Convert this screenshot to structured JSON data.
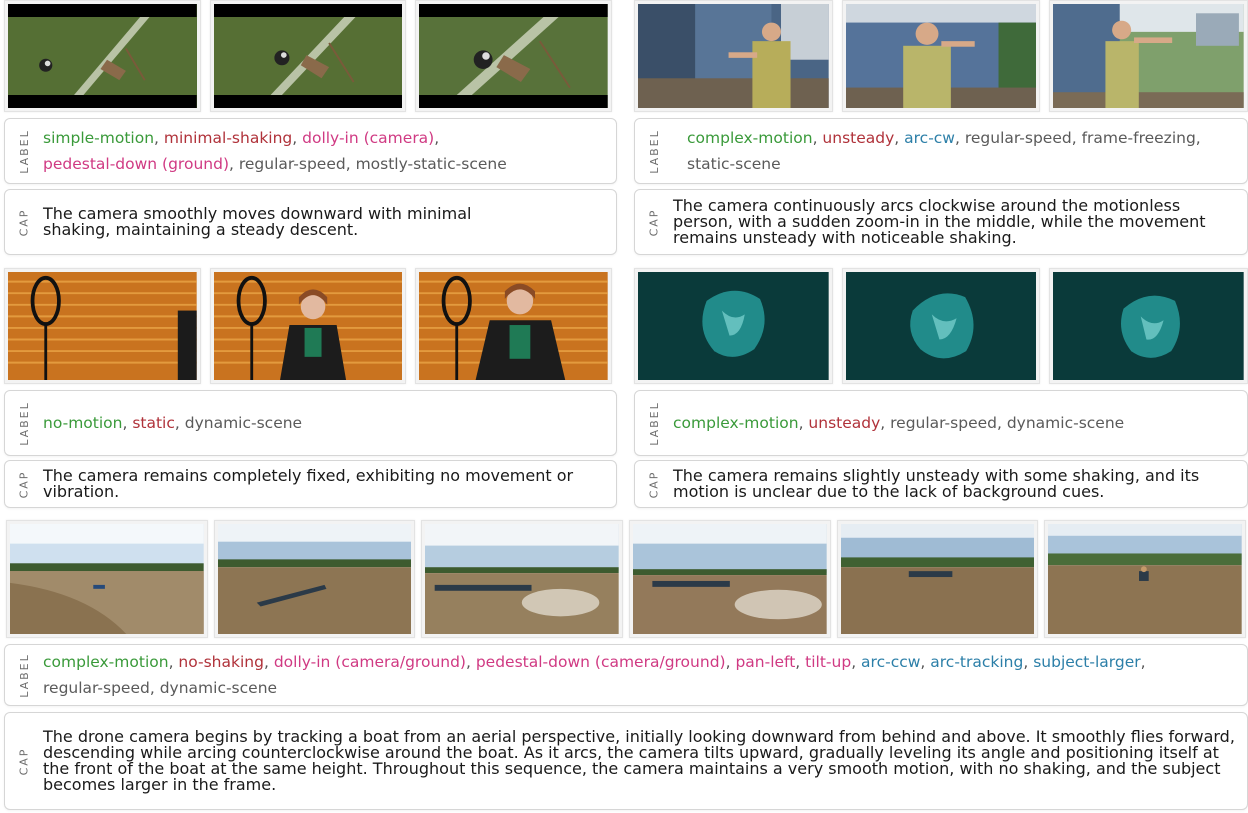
{
  "labels": {
    "label_tag": "LABEL",
    "caption_tag": "CAP"
  },
  "colors": {
    "green": "#3a9a3a",
    "red": "#b0323a",
    "pink": "#d03a83",
    "blue": "#2c7fa8",
    "gray": "#5a5a5a"
  },
  "examples": [
    {
      "tags": [
        {
          "text": "simple-motion",
          "color": "green"
        },
        {
          "text": "minimal-shaking",
          "color": "red"
        },
        {
          "text": "dolly-in (camera)",
          "color": "pink"
        },
        {
          "text": "pedestal-down (ground)",
          "color": "pink"
        },
        {
          "text": "regular-speed",
          "color": "gray"
        },
        {
          "text": "mostly-static-scene",
          "color": "gray"
        }
      ],
      "caption": "The camera smoothly moves downward with minimal shaking, maintaining a steady descent.",
      "frame_icons": [
        "field-frame-icon",
        "field-frame-icon",
        "field-frame-icon"
      ]
    },
    {
      "tags": [
        {
          "text": "complex-motion",
          "color": "green"
        },
        {
          "text": "unsteady",
          "color": "red"
        },
        {
          "text": "arc-cw",
          "color": "blue"
        },
        {
          "text": "regular-speed",
          "color": "gray"
        },
        {
          "text": "frame-freezing",
          "color": "gray"
        },
        {
          "text": "static-scene",
          "color": "gray"
        }
      ],
      "caption": "The camera continuously arcs clockwise around the motionless person, with a sudden zoom-in in the middle, while the movement remains unsteady with noticeable shaking.",
      "frame_icons": [
        "house-frame-icon",
        "house-frame-icon",
        "house-frame-icon"
      ]
    },
    {
      "tags": [
        {
          "text": "no-motion",
          "color": "green"
        },
        {
          "text": "static",
          "color": "red"
        },
        {
          "text": "dynamic-scene",
          "color": "gray"
        }
      ],
      "caption": "The camera remains completely fixed, exhibiting no movement or vibration.",
      "frame_icons": [
        "studio-frame-icon",
        "studio-frame-icon",
        "studio-frame-icon"
      ]
    },
    {
      "tags": [
        {
          "text": "complex-motion",
          "color": "green"
        },
        {
          "text": "unsteady",
          "color": "red"
        },
        {
          "text": "regular-speed",
          "color": "gray"
        },
        {
          "text": "dynamic-scene",
          "color": "gray"
        }
      ],
      "caption": "The camera remains slightly unsteady with some shaking, and its motion is unclear due to the lack of background cues.",
      "frame_icons": [
        "jellyfish-frame-icon",
        "jellyfish-frame-icon",
        "jellyfish-frame-icon"
      ]
    },
    {
      "tags": [
        {
          "text": "complex-motion",
          "color": "green"
        },
        {
          "text": "no-shaking",
          "color": "red"
        },
        {
          "text": "dolly-in (camera/ground)",
          "color": "pink"
        },
        {
          "text": "pedestal-down (camera/ground)",
          "color": "pink"
        },
        {
          "text": "pan-left",
          "color": "pink"
        },
        {
          "text": "tilt-up",
          "color": "pink"
        },
        {
          "text": "arc-ccw",
          "color": "blue"
        },
        {
          "text": "arc-tracking",
          "color": "blue"
        },
        {
          "text": "subject-larger",
          "color": "blue"
        },
        {
          "text": "regular-speed",
          "color": "gray"
        },
        {
          "text": "dynamic-scene",
          "color": "gray"
        }
      ],
      "caption": "The drone camera begins by tracking a boat from an aerial perspective, initially looking downward from behind and above. It smoothly flies forward, descending while arcing counterclockwise around the boat. As it arcs, the camera tilts upward, gradually leveling its angle and positioning itself at the front of the boat at the same height. Throughout this sequence, the camera maintains a very smooth motion, with no shaking, and the subject becomes larger in the frame.",
      "frame_icons": [
        "river-frame-icon",
        "river-frame-icon",
        "river-frame-icon",
        "river-frame-icon",
        "river-frame-icon",
        "river-frame-icon"
      ]
    }
  ]
}
